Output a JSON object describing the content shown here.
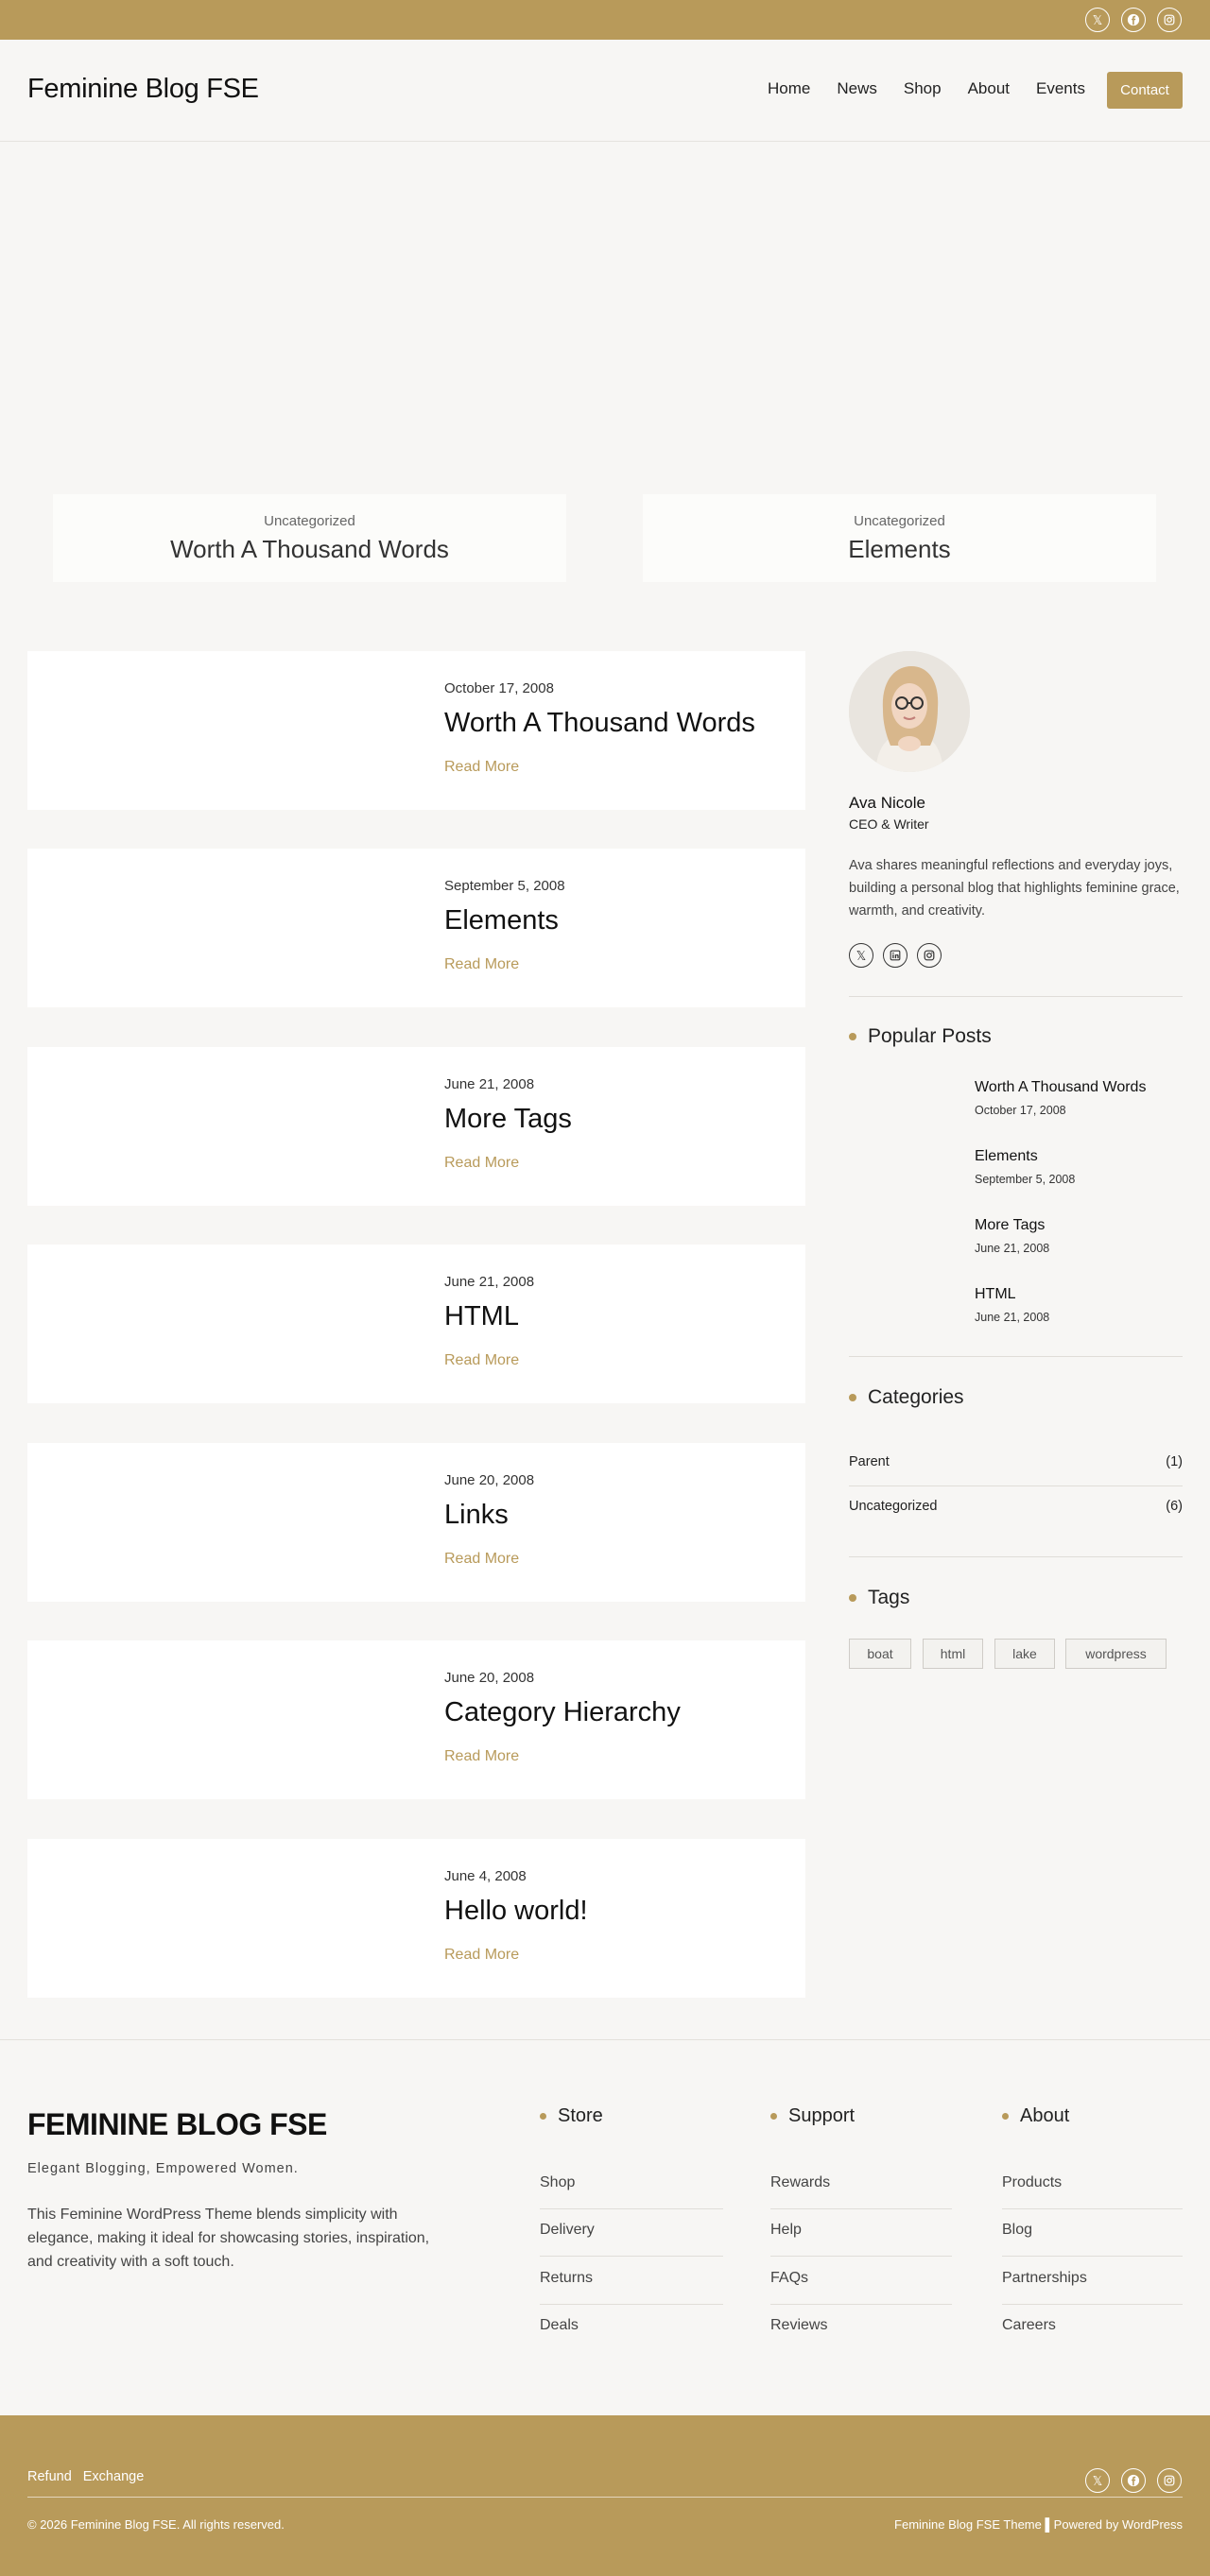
{
  "site": {
    "title": "Feminine Blog FSE"
  },
  "nav": {
    "items": [
      "Home",
      "News",
      "Shop",
      "About",
      "Events"
    ],
    "contact_label": "Contact"
  },
  "featured": [
    {
      "category": "Uncategorized",
      "title": "Worth A Thousand Words"
    },
    {
      "category": "Uncategorized",
      "title": "Elements"
    }
  ],
  "posts": [
    {
      "date": "October 17, 2008",
      "title": "Worth A Thousand Words",
      "more": "Read More"
    },
    {
      "date": "September 5, 2008",
      "title": "Elements",
      "more": "Read More"
    },
    {
      "date": "June 21, 2008",
      "title": "More Tags",
      "more": "Read More"
    },
    {
      "date": "June 21, 2008",
      "title": "HTML",
      "more": "Read More"
    },
    {
      "date": "June 20, 2008",
      "title": "Links",
      "more": "Read More"
    },
    {
      "date": "June 20, 2008",
      "title": "Category Hierarchy",
      "more": "Read More"
    },
    {
      "date": "June 4, 2008",
      "title": "Hello world!",
      "more": "Read More"
    }
  ],
  "author": {
    "name": "Ava Nicole",
    "role": "CEO & Writer",
    "bio": "Ava shares meaningful reflections and everyday joys, building a personal blog that highlights feminine grace, warmth, and creativity.",
    "socials": [
      "x-icon",
      "linkedin-icon",
      "instagram-icon"
    ]
  },
  "popular": {
    "title": "Popular Posts",
    "items": [
      {
        "title": "Worth A Thousand Words",
        "date": "October 17, 2008"
      },
      {
        "title": "Elements",
        "date": "September 5, 2008"
      },
      {
        "title": "More Tags",
        "date": "June 21, 2008"
      },
      {
        "title": "HTML",
        "date": "June 21, 2008"
      }
    ]
  },
  "categories": {
    "title": "Categories",
    "items": [
      {
        "name": "Parent",
        "count": "(1)"
      },
      {
        "name": "Uncategorized",
        "count": "(6)"
      }
    ]
  },
  "tags": {
    "title": "Tags",
    "items": [
      "boat",
      "html",
      "lake",
      "wordpress"
    ]
  },
  "footer": {
    "brand": "FEMININE BLOG FSE",
    "tagline": "Elegant Blogging, Empowered Women.",
    "description": "This Feminine WordPress Theme blends simplicity with elegance, making it ideal for showcasing stories, inspiration, and creativity with a soft touch.",
    "columns": [
      {
        "title": "Store",
        "links": [
          "Shop",
          "Delivery",
          "Returns",
          "Deals"
        ]
      },
      {
        "title": "Support",
        "links": [
          "Rewards",
          "Help",
          "FAQs",
          "Reviews"
        ]
      },
      {
        "title": "About",
        "links": [
          "Products",
          "Blog",
          "Partnerships",
          "Careers"
        ]
      }
    ]
  },
  "bottom": {
    "links": [
      "Refund",
      "Exchange"
    ],
    "copyright": "© 2026 Feminine Blog FSE. All rights reserved.",
    "credit": "Feminine Blog FSE Theme ▌Powered by WordPress"
  },
  "colors": {
    "accent": "#b89a5a",
    "background": "#f7f6f4",
    "card": "#ffffff"
  },
  "header_socials": [
    "x-icon",
    "facebook-icon",
    "instagram-icon"
  ]
}
